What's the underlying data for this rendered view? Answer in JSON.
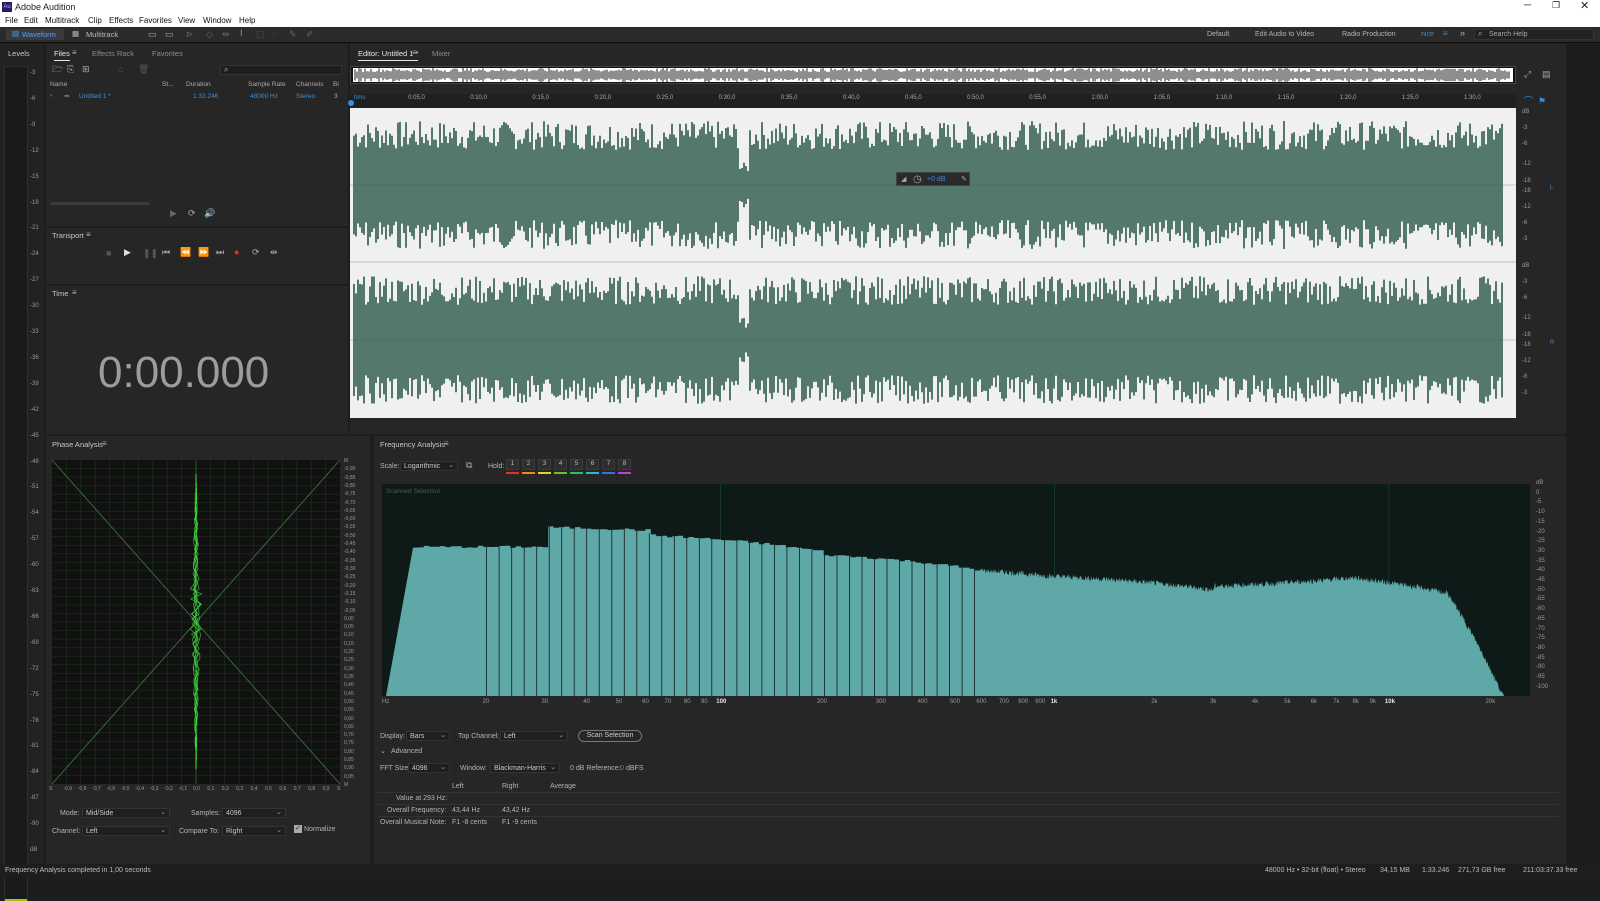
{
  "app": {
    "title": "Adobe Audition",
    "menu": [
      "File",
      "Edit",
      "Multitrack",
      "Clip",
      "Effects",
      "Favorites",
      "View",
      "Window",
      "Help"
    ]
  },
  "toolbar": {
    "waveform": "Waveform",
    "multitrack": "Multitrack",
    "workspaces": [
      "Default",
      "Edit Audio to Video",
      "Radio Production",
      "nice"
    ],
    "search_placeholder": "Search Help"
  },
  "levels": {
    "title": "Levels",
    "scale": [
      "-3",
      "-6",
      "-9",
      "-12",
      "-15",
      "-18",
      "-21",
      "-24",
      "-27",
      "-30",
      "-33",
      "-36",
      "-39",
      "-42",
      "-45",
      "-48",
      "-51",
      "-54",
      "-57",
      "-60",
      "-63",
      "-66",
      "-69",
      "-72",
      "-75",
      "-78",
      "-81",
      "-84",
      "-87",
      "-90",
      "dB"
    ]
  },
  "files": {
    "tabs": [
      "Files",
      "Effects Rack",
      "Favorites"
    ],
    "columns": [
      "Name",
      "St...",
      "Duration",
      "Sample Rate",
      "Channels",
      "Bi"
    ],
    "rows": [
      {
        "name": "Untitled 1 *",
        "duration": "1:33.246",
        "rate": "48000 Hz",
        "channels": "Stereo",
        "bits": "3"
      }
    ]
  },
  "transport": {
    "title": "Transport"
  },
  "time": {
    "title": "Time",
    "value": "0:00.000"
  },
  "editor": {
    "tabs": [
      "Editor: Untitled 1 *",
      "Mixer"
    ],
    "timeline": [
      "hms",
      "0:05,0",
      "0:10,0",
      "0:15,0",
      "0:20,0",
      "0:25,0",
      "0:30,0",
      "0:35,0",
      "0:40,0",
      "0:45,0",
      "0:50,0",
      "0:55,0",
      "1:00,0",
      "1:05,0",
      "1:10,0",
      "1:15,0",
      "1:20,0",
      "1:25,0",
      "1:30,0"
    ],
    "db_scale": [
      "dB",
      "-3",
      "-6",
      "-12",
      "-18",
      "-18",
      "-12",
      "-6",
      "-3"
    ],
    "gain": "+0 dB",
    "left_label": "L",
    "right_label": "R"
  },
  "phase": {
    "title": "Phase Analysis",
    "right_scale": [
      "M",
      "-0,90",
      "-0,85",
      "-0,80",
      "-0,75",
      "-0,70",
      "-0,65",
      "-0,60",
      "-0,55",
      "-0,50",
      "-0,45",
      "-0,40",
      "-0,35",
      "-0,30",
      "-0,25",
      "-0,20",
      "-0,15",
      "-0,10",
      "-0,05",
      "0,00",
      "0,05",
      "0,10",
      "0,15",
      "0,20",
      "0,25",
      "0,30",
      "0,35",
      "0,40",
      "0,45",
      "0,50",
      "0,55",
      "0,60",
      "0,65",
      "0,70",
      "0,75",
      "0,80",
      "0,85",
      "0,90",
      "0,95",
      "M"
    ],
    "bottom_scale": [
      "S",
      "-0,9",
      "-0,8",
      "-0,7",
      "-0,6",
      "-0,5",
      "-0,4",
      "-0,3",
      "-0,2",
      "-0,1",
      "0,0",
      "0,1",
      "0,2",
      "0,3",
      "0,4",
      "0,5",
      "0,6",
      "0,7",
      "0,8",
      "0,9",
      "S"
    ],
    "mode_label": "Mode:",
    "mode": "Mid/Side",
    "samples_label": "Samples:",
    "samples": "4096",
    "channel_label": "Channel:",
    "channel": "Left",
    "compare_label": "Compare To:",
    "compare": "Right",
    "normalize": "Normalize"
  },
  "freq": {
    "title": "Frequency Analysis",
    "scale_label": "Scale:",
    "scale": "Logarithmic",
    "hold_label": "Hold:",
    "holds": [
      "1",
      "2",
      "3",
      "4",
      "5",
      "6",
      "7",
      "8"
    ],
    "hold_colors": [
      "#e0302c",
      "#e88a1c",
      "#e6d21c",
      "#63c52b",
      "#2bbd63",
      "#2bb8d8",
      "#3a6fe0",
      "#c83ad8"
    ],
    "scanned": "Scanned Selection",
    "x_ticks": [
      "Hz",
      "20",
      "30",
      "40",
      "50",
      "60",
      "70",
      "80",
      "90",
      "100",
      "200",
      "300",
      "400",
      "500",
      "600",
      "700",
      "800",
      "900",
      "1k",
      "2k",
      "3k",
      "4k",
      "5k",
      "6k",
      "7k",
      "8k",
      "9k",
      "10k",
      "20k"
    ],
    "y_ticks": [
      "dB",
      "0",
      "-5",
      "-10",
      "-15",
      "-20",
      "-25",
      "-30",
      "-35",
      "-40",
      "-45",
      "-50",
      "-55",
      "-60",
      "-65",
      "-70",
      "-75",
      "-80",
      "-85",
      "-90",
      "-95",
      "-100"
    ],
    "display_label": "Display:",
    "display": "Bars",
    "top_channel_label": "Top Channel:",
    "top_channel": "Left",
    "scan_button": "Scan Selection",
    "advanced": "Advanced",
    "fft_label": "FFT Size:",
    "fft": "4096",
    "window_label": "Window:",
    "window": "Blackman-Harris",
    "ref_label": "0 dB Reference:",
    "ref_value": "0",
    "ref_unit": "dBFS",
    "table_headers": [
      "Left",
      "Right",
      "Average"
    ],
    "value_at": "Value at 293 Hz:",
    "overall_freq_label": "Overall Frequency:",
    "overall_freq_left": "43,44 Hz",
    "overall_freq_right": "43,42 Hz",
    "overall_note_label": "Overall Musical Note:",
    "overall_note_left": "F1 -8 cents",
    "overall_note_right": "F1 -9 cents"
  },
  "status": {
    "left": "Frequency Analysis completed in 1,00 seconds",
    "items": [
      "48000 Hz • 32-bit (float) • Stereo",
      "34,15 MB",
      "1:33.246",
      "271,73 GB free",
      "211:03:37.33 free"
    ]
  },
  "colors": {
    "accent": "#3b8edb",
    "waveform": "#2d5a4a",
    "spectrum": "#5fa8a8",
    "phase": "#3fe03f"
  }
}
